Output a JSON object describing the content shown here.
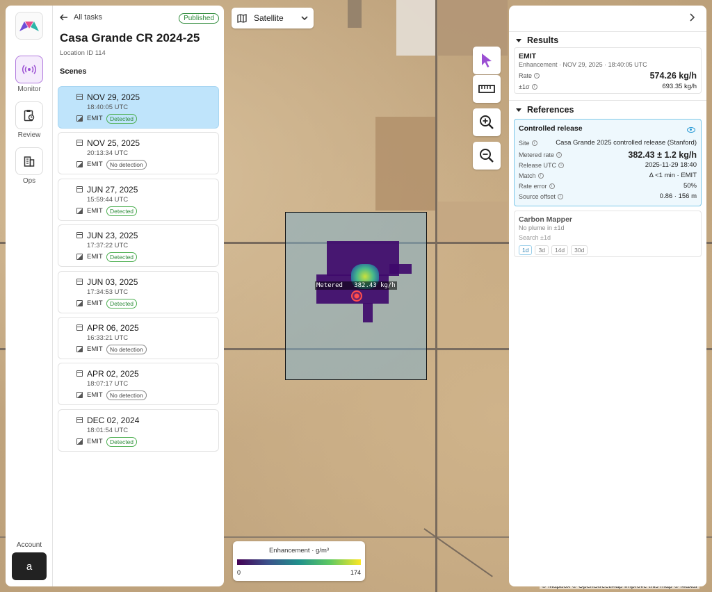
{
  "rail": {
    "items": [
      {
        "label": "Monitor"
      },
      {
        "label": "Review"
      },
      {
        "label": "Ops"
      }
    ],
    "account_label": "Account",
    "avatar_letter": "a"
  },
  "task": {
    "back_label": "All tasks",
    "status": "Published",
    "title": "Casa Grande CR 2024-25",
    "location": "Location ID 114",
    "scenes_heading": "Scenes",
    "scenes": [
      {
        "date": "NOV 29, 2025",
        "time": "18:40:05 UTC",
        "instrument": "EMIT",
        "status": "Detected",
        "selected": true
      },
      {
        "date": "NOV 25, 2025",
        "time": "20:13:34 UTC",
        "instrument": "EMIT",
        "status": "No detection"
      },
      {
        "date": "JUN 27, 2025",
        "time": "15:59:44 UTC",
        "instrument": "EMIT",
        "status": "Detected"
      },
      {
        "date": "JUN 23, 2025",
        "time": "17:37:22 UTC",
        "instrument": "EMIT",
        "status": "Detected"
      },
      {
        "date": "JUN 03, 2025",
        "time": "17:34:53 UTC",
        "instrument": "EMIT",
        "status": "Detected"
      },
      {
        "date": "APR 06, 2025",
        "time": "16:33:21 UTC",
        "instrument": "EMIT",
        "status": "No detection"
      },
      {
        "date": "APR 02, 2025",
        "time": "18:07:17 UTC",
        "instrument": "EMIT",
        "status": "No detection"
      },
      {
        "date": "DEC 02, 2024",
        "time": "18:01:54 UTC",
        "instrument": "EMIT",
        "status": "Detected"
      }
    ]
  },
  "map": {
    "basemap": "Satellite",
    "plume_label": "Metered   382.43 kg/h",
    "colorbar": {
      "title": "Enhancement · g/m³",
      "min": "0",
      "max": "174"
    },
    "attribution": "© Mapbox © OpenStreetMap Improve this map © Maxar"
  },
  "results": {
    "heading": "Results",
    "emit": {
      "title": "EMIT",
      "subtitle": "Enhancement · NOV 29, 2025 · 18:40:05 UTC",
      "rate_label": "Rate",
      "rate_value": "574.26 kg/h",
      "sigma_label": "±1σ",
      "sigma_value": "693.35 kg/h"
    },
    "references_heading": "References",
    "controlled": {
      "title": "Controlled release",
      "rows": [
        {
          "k": "Site",
          "v": "Casa Grande 2025 controlled release (Stanford)"
        },
        {
          "k": "Metered rate",
          "v": "382.43 ± 1.2 kg/h"
        },
        {
          "k": "Release UTC",
          "v": "2025-11-29 18:40"
        },
        {
          "k": "Match",
          "v": "Δ <1 min · EMIT"
        },
        {
          "k": "Rate error",
          "v": "50%"
        },
        {
          "k": "Source offset",
          "v": "0.86 · 156 m"
        }
      ]
    },
    "carbon_mapper": {
      "title": "Carbon Mapper",
      "subtitle": "No plume in ±1d",
      "search_label": "Search ±1d",
      "chips": [
        "1d",
        "3d",
        "14d",
        "30d"
      ]
    }
  },
  "colors": {
    "accent": "#9b4fd3",
    "selected_scene": "#bfe4fb",
    "detected": "#2e8b3a",
    "reference_border": "#7cc7e8"
  }
}
